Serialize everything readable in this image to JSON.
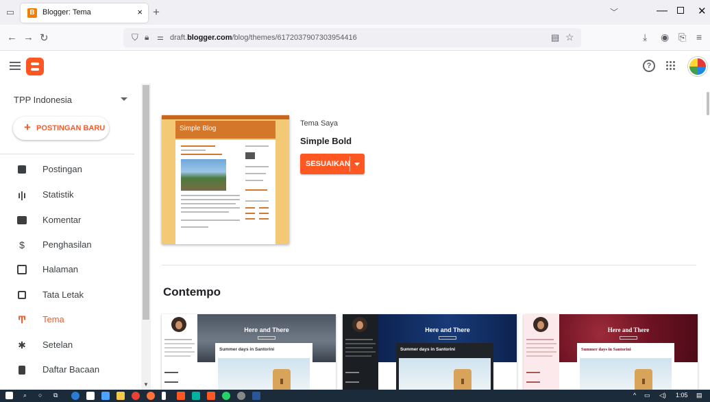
{
  "browser": {
    "tab_title": "Blogger: Tema",
    "tab_close": "×",
    "new_tab": "+",
    "url_prefix": "draft.",
    "url_domain": "blogger.com",
    "url_path": "/blog/themes/6172037907303954416",
    "icons": [
      "tab-list-icon",
      "back-icon",
      "forward-icon",
      "reload-icon",
      "shield-icon",
      "lock-icon",
      "permissions-icon",
      "reader-view-icon",
      "bookmark-star-icon",
      "download-icon",
      "account-icon",
      "extensions-icon",
      "menu-icon"
    ]
  },
  "header": {
    "help_symbol": "?"
  },
  "sidebar": {
    "blog_name": "TPP Indonesia",
    "new_post_label": "POSTINGAN BARU",
    "items": [
      {
        "label": "Postingan",
        "icon": "posts-icon"
      },
      {
        "label": "Statistik",
        "icon": "stats-icon"
      },
      {
        "label": "Komentar",
        "icon": "comments-icon"
      },
      {
        "label": "Penghasilan",
        "icon": "earnings-icon"
      },
      {
        "label": "Halaman",
        "icon": "pages-icon"
      },
      {
        "label": "Tata Letak",
        "icon": "layout-icon"
      },
      {
        "label": "Tema",
        "icon": "theme-icon",
        "active": true
      },
      {
        "label": "Setelan",
        "icon": "settings-icon"
      },
      {
        "label": "Daftar Bacaan",
        "icon": "reading-list-icon"
      }
    ]
  },
  "main": {
    "current_theme": {
      "thumbnail_title": "Simple Blog",
      "label": "Tema Saya",
      "name": "Simple Bold",
      "customize_label": "SESUAIKAN"
    },
    "section_title": "Contempo",
    "theme_cards": [
      {
        "hero_title": "Here and There",
        "post_title": "Summer days in Santorini",
        "variant": "light"
      },
      {
        "hero_title": "Here and There",
        "post_title": "Summer days in Santorini",
        "variant": "dark"
      },
      {
        "hero_title": "Here and There",
        "post_title": "Summer days in Santorini",
        "variant": "red"
      }
    ]
  },
  "taskbar": {
    "time": "1:05"
  },
  "colors": {
    "accent": "#ff5722",
    "text": "#3c4043"
  }
}
